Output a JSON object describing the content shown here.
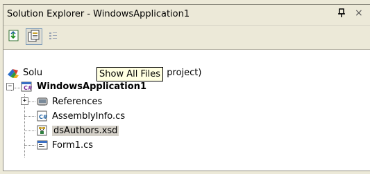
{
  "window": {
    "title": "Solution Explorer - WindowsApplication1",
    "pin_glyph": "V",
    "close_glyph": "×"
  },
  "toolbar": {
    "buttons": [
      {
        "name": "properties-button",
        "icon": "properties-icon"
      },
      {
        "name": "show-all-files-button",
        "icon": "show-all-files-icon",
        "pressed": true
      },
      {
        "name": "refresh-button",
        "icon": "refresh-icon"
      }
    ]
  },
  "tooltip": {
    "text": "Show All Files"
  },
  "tree": {
    "solution_prefix": "Solu",
    "solution_suffix": "pplication1' (1 project)",
    "project": "WindowsApplication1",
    "items": [
      {
        "label": "References",
        "icon": "references-icon"
      },
      {
        "label": "AssemblyInfo.cs",
        "icon": "csharp-file-icon"
      },
      {
        "label": "dsAuthors.xsd",
        "icon": "dataset-icon",
        "selected": true
      },
      {
        "label": "Form1.cs",
        "icon": "form-icon"
      }
    ]
  },
  "colors": {
    "panel": "#ece9d8",
    "tooltip_bg": "#ffffe1",
    "selection": "#d4d0c8"
  }
}
